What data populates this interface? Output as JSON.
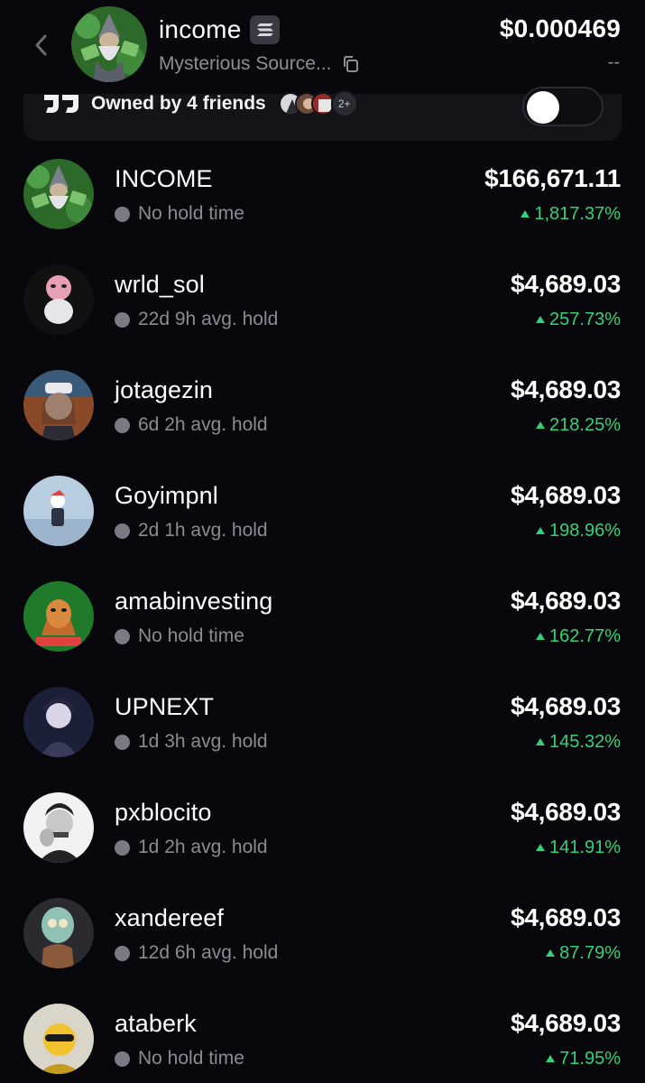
{
  "header": {
    "token_name": "income",
    "source": "Mysterious Source...",
    "price": "$0.000469",
    "change": "--"
  },
  "owned": {
    "text": "Owned by 4 friends",
    "more": "2+",
    "toggle_on": false
  },
  "colors": {
    "background": "#07070c",
    "card": "#131318",
    "positive": "#36d07a",
    "muted": "#8b8b95"
  },
  "holders": [
    {
      "name": "INCOME",
      "hold": "No hold time",
      "value": "$166,671.11",
      "pct": "1,817.37%"
    },
    {
      "name": "wrld_sol",
      "hold": "22d 9h avg. hold",
      "value": "$4,689.03",
      "pct": "257.73%"
    },
    {
      "name": "jotagezin",
      "hold": "6d 2h avg. hold",
      "value": "$4,689.03",
      "pct": "218.25%"
    },
    {
      "name": "Goyimpnl",
      "hold": "2d 1h avg. hold",
      "value": "$4,689.03",
      "pct": "198.96%"
    },
    {
      "name": "amabinvesting",
      "hold": "No hold time",
      "value": "$4,689.03",
      "pct": "162.77%"
    },
    {
      "name": "UPNEXT",
      "hold": "1d 3h avg. hold",
      "value": "$4,689.03",
      "pct": "145.32%"
    },
    {
      "name": "pxblocito",
      "hold": "1d 2h avg. hold",
      "value": "$4,689.03",
      "pct": "141.91%"
    },
    {
      "name": "xandereef",
      "hold": "12d 6h avg. hold",
      "value": "$4,689.03",
      "pct": "87.79%"
    },
    {
      "name": "ataberk",
      "hold": "No hold time",
      "value": "$4,689.03",
      "pct": "71.95%"
    }
  ]
}
